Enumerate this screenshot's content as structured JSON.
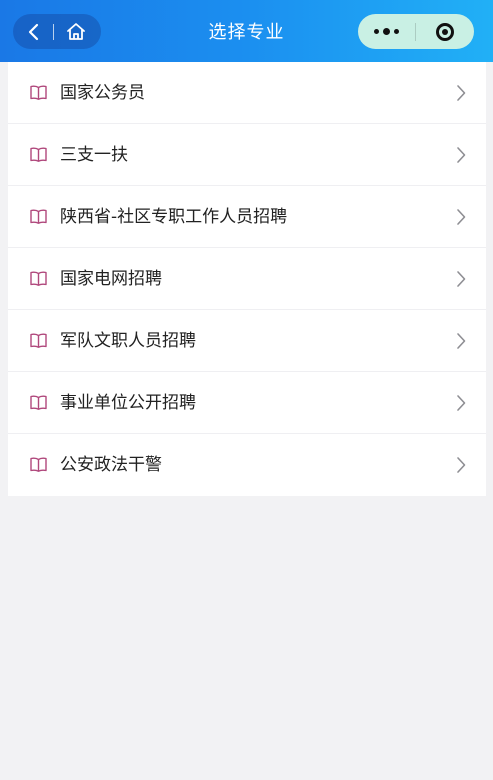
{
  "header": {
    "title": "选择专业",
    "back_icon": "chevron-left-icon",
    "home_icon": "home-icon",
    "more_icon": "more-dots-icon",
    "close_icon": "target-close-icon",
    "colors": {
      "gradient_start": "#1a78e6",
      "gradient_end": "#21b0f6",
      "capsule": "#c9f0e4"
    }
  },
  "majors": {
    "items": [
      {
        "label": "国家公务员"
      },
      {
        "label": "三支一扶"
      },
      {
        "label": "陕西省-社区专职工作人员招聘"
      },
      {
        "label": "国家电网招聘"
      },
      {
        "label": "军队文职人员招聘"
      },
      {
        "label": "事业单位公开招聘"
      },
      {
        "label": "公安政法干警"
      }
    ],
    "item_icon": "book-icon",
    "item_icon_color": "#b0487c",
    "arrow_icon": "chevron-right-icon"
  }
}
